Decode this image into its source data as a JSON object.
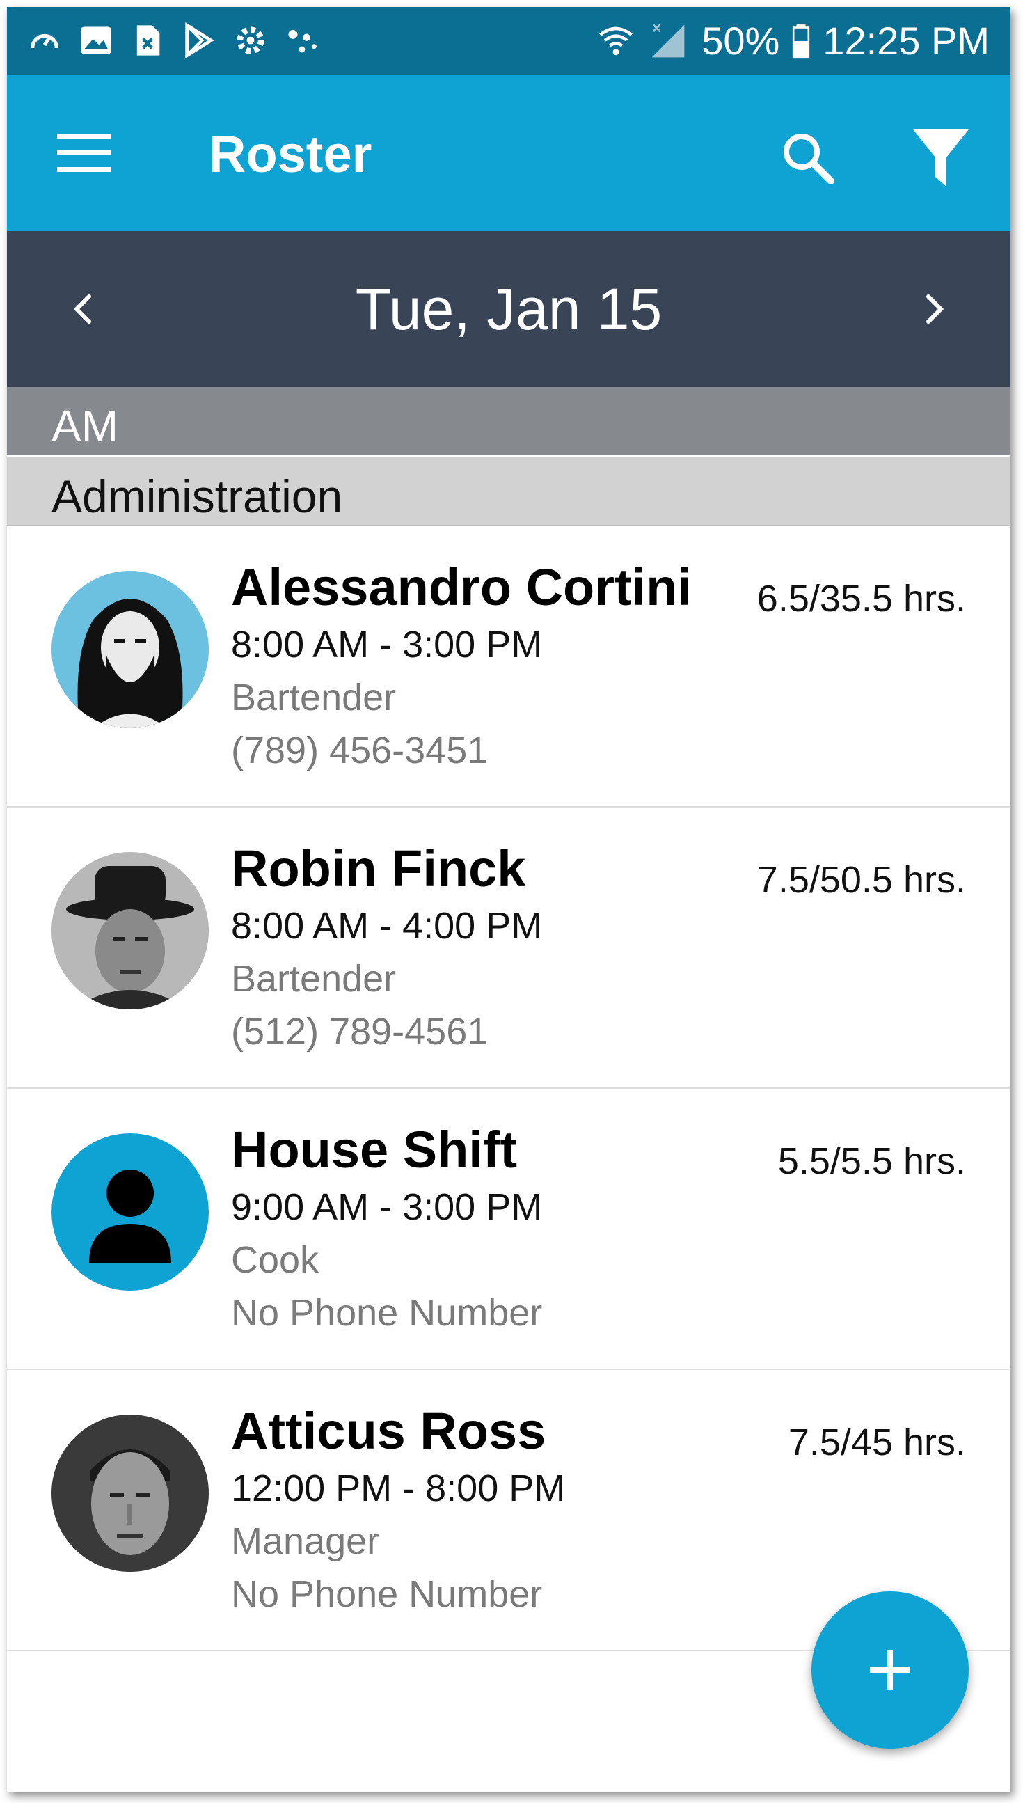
{
  "status_bar": {
    "battery": "50%",
    "time": "12:25 PM",
    "left_icons": [
      "speedometer-icon",
      "image-icon",
      "file-x-icon",
      "play-store-icon",
      "gear-cog-icon",
      "dots-icon"
    ],
    "right_icons": [
      "wifi-icon",
      "signal-icon",
      "battery-icon"
    ]
  },
  "app_bar": {
    "title": "Roster",
    "menu_icon": "hamburger-menu-icon",
    "search_icon": "search-icon",
    "filter_icon": "filter-icon",
    "color": "#0ea3d2"
  },
  "date_nav": {
    "date": "Tue, Jan 15",
    "prev_icon": "chevron-left-icon",
    "next_icon": "chevron-right-icon",
    "color": "#3a4457"
  },
  "shift_section": "AM",
  "department": "Administration",
  "employees": [
    {
      "name": "Alessandro Cortini",
      "time": "8:00 AM - 3:00 PM",
      "role": "Bartender",
      "phone": "(789) 456-3451",
      "hours": "6.5/35.5 hrs.",
      "avatar": "photo"
    },
    {
      "name": "Robin Finck",
      "time": "8:00 AM - 4:00 PM",
      "role": "Bartender",
      "phone": "(512) 789-4561",
      "hours": "7.5/50.5 hrs.",
      "avatar": "photo"
    },
    {
      "name": "House Shift",
      "time": "9:00 AM - 3:00 PM",
      "role": "Cook",
      "phone": "No Phone Number",
      "hours": "5.5/5.5 hrs.",
      "avatar": "placeholder-person-icon"
    },
    {
      "name": "Atticus Ross",
      "time": "12:00 PM - 8:00 PM",
      "role": "Manager",
      "phone": "No Phone Number",
      "hours": "7.5/45 hrs.",
      "avatar": "photo"
    }
  ],
  "fab": {
    "icon": "plus-icon"
  }
}
